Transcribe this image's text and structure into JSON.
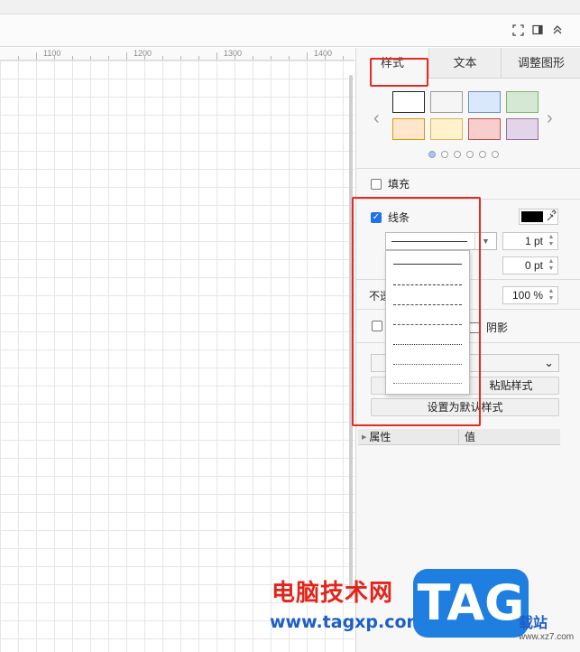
{
  "toolbar": {
    "icons": [
      "fullscreen-icon",
      "panel-toggle-icon",
      "collapse-up-icon"
    ]
  },
  "ruler": {
    "labels": [
      "1100",
      "1200",
      "1300",
      "1400"
    ]
  },
  "panel": {
    "tabs": [
      {
        "label": "样式",
        "active": true
      },
      {
        "label": "文本",
        "active": false
      },
      {
        "label": "调整图形",
        "active": false
      }
    ],
    "swatch_colors": [
      "#ffffff",
      "#f5f5f5",
      "#dae8fc",
      "#d5e8d4",
      "#ffe6cc",
      "#fff2cc",
      "#f8cecc",
      "#e1d5e7"
    ],
    "page_dots": 6,
    "fill": {
      "label": "填充",
      "checked": false
    },
    "line": {
      "label": "线条",
      "checked": true,
      "color": "#000000",
      "width_value": "1 pt"
    },
    "spacing_value": "0 pt",
    "opacity": {
      "label_partial": "不透",
      "value": "100 %"
    },
    "shadow": {
      "label": "阴影",
      "checked": false
    },
    "paste_style_label": "粘贴样式",
    "set_default_label": "设置为默认样式",
    "properties": {
      "col_property": "属性",
      "col_value": "值"
    }
  },
  "line_styles": [
    "solid",
    "dashed",
    "dashed-long",
    "dashed-short",
    "dotted",
    "dotted-fine",
    "dotted-sparse"
  ],
  "watermark": {
    "site_name": "电脑技术网",
    "site_url": "www.tagxp.com",
    "logo_text": "TAG",
    "logo_sub": "载站",
    "logo_url": "www.xz7.com"
  },
  "colors": {
    "accent": "#1e73e8",
    "highlight": "#e52b22"
  }
}
